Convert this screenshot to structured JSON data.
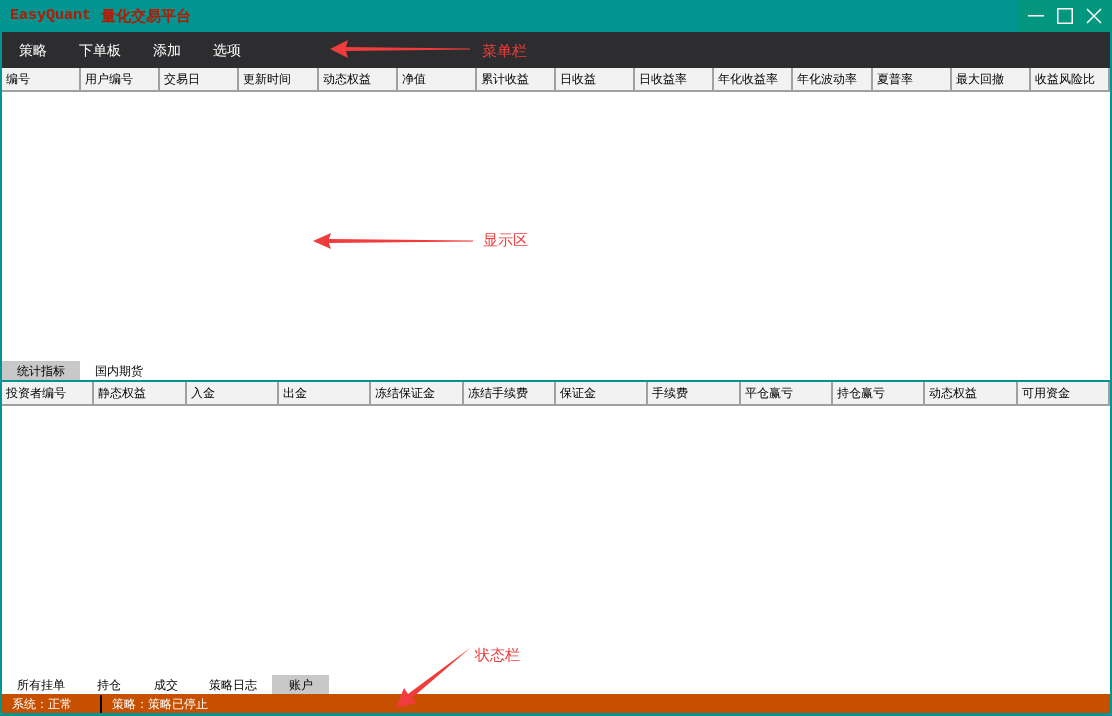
{
  "window": {
    "title_latin": "EasyQuant",
    "title_cjk": "量化交易平台"
  },
  "menu": [
    "策略",
    "下单板",
    "添加",
    "选项"
  ],
  "top_table": {
    "columns": [
      "编号",
      "用户编号",
      "交易日",
      "更新时间",
      "动态权益",
      "净值",
      "累计收益",
      "日收益",
      "日收益率",
      "年化收益率",
      "年化波动率",
      "夏普率",
      "最大回撤",
      "收益风险比"
    ]
  },
  "top_tabs": [
    {
      "label": "统计指标",
      "selected": true
    },
    {
      "label": "国内期货",
      "selected": false
    }
  ],
  "bottom_table": {
    "columns": [
      "投资者编号",
      "静态权益",
      "入金",
      "出金",
      "冻结保证金",
      "冻结手续费",
      "保证金",
      "手续费",
      "平仓赢亏",
      "持仓赢亏",
      "动态权益",
      "可用资金"
    ]
  },
  "bottom_tabs": [
    {
      "label": "所有挂单",
      "selected": false
    },
    {
      "label": "持仓",
      "selected": false
    },
    {
      "label": "成交",
      "selected": false
    },
    {
      "label": "策略日志",
      "selected": false
    },
    {
      "label": "账户",
      "selected": true
    }
  ],
  "status_bar": [
    "系统：正常",
    "策略：策略已停止"
  ],
  "annotations": [
    {
      "label": "菜单栏"
    },
    {
      "label": "显示区"
    },
    {
      "label": "状态栏"
    }
  ]
}
